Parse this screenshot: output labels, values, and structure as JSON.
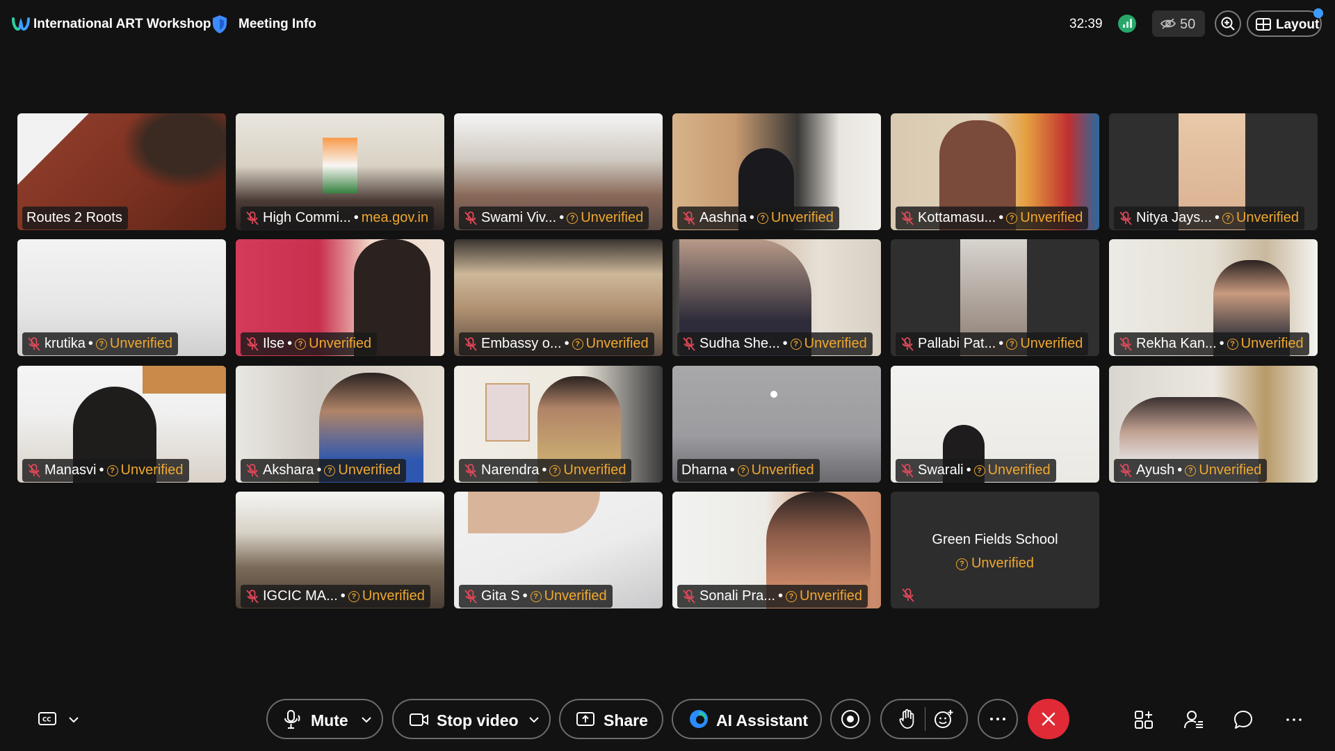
{
  "topbar": {
    "meeting_title": "International ART Workshop",
    "meeting_info": "Meeting Info",
    "timer": "32:39",
    "hidden_count": "50",
    "layout_label": "Layout"
  },
  "participants": [
    {
      "name": "Routes 2 Roots",
      "status": ""
    },
    {
      "name": "High Commi...",
      "status": "mea.gov.in"
    },
    {
      "name": "Swami Viv...",
      "status": "Unverified"
    },
    {
      "name": "Aashna",
      "status": "Unverified"
    },
    {
      "name": "Kottamasu...",
      "status": "Unverified"
    },
    {
      "name": "Nitya Jays...",
      "status": "Unverified"
    },
    {
      "name": "krutika",
      "status": "Unverified"
    },
    {
      "name": "Ilse",
      "status": "Unverified"
    },
    {
      "name": "Embassy o...",
      "status": "Unverified"
    },
    {
      "name": "Sudha She...",
      "status": "Unverified"
    },
    {
      "name": "Pallabi Pat...",
      "status": "Unverified"
    },
    {
      "name": "Rekha Kan...",
      "status": "Unverified"
    },
    {
      "name": "Manasvi",
      "status": "Unverified"
    },
    {
      "name": "Akshara",
      "status": "Unverified"
    },
    {
      "name": "Narendra",
      "status": "Unverified"
    },
    {
      "name": "Dharna",
      "status": "Unverified"
    },
    {
      "name": "Swarali",
      "status": "Unverified"
    },
    {
      "name": "Ayush",
      "status": "Unverified"
    },
    {
      "name": "IGCIC MA...",
      "status": "Unverified"
    },
    {
      "name": "Gita S",
      "status": "Unverified"
    },
    {
      "name": "Sonali Pra...",
      "status": "Unverified"
    },
    {
      "name": "Green Fields School",
      "status": "Unverified"
    }
  ],
  "controls": {
    "mute_label": "Mute",
    "stop_video_label": "Stop video",
    "share_label": "Share",
    "ai_assistant_label": "AI Assistant"
  },
  "colors": {
    "background": "#121212",
    "unverified": "#f0a830",
    "end_call": "#e02a36",
    "layout_dot": "#3d9bff"
  }
}
